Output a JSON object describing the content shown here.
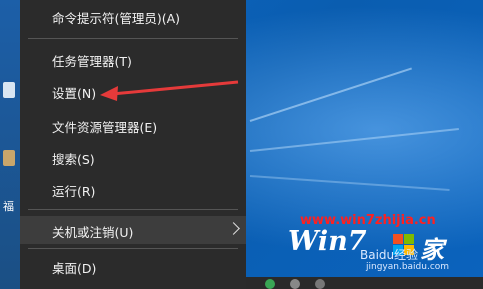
{
  "menu": {
    "items": [
      {
        "label": "命令提示符(管理员)(A)"
      },
      {
        "label": "任务管理器(T)"
      },
      {
        "label": "设置(N)"
      },
      {
        "label": "文件资源管理器(E)"
      },
      {
        "label": "搜索(S)"
      },
      {
        "label": "运行(R)"
      },
      {
        "label": "关机或注销(U)"
      },
      {
        "label": "桌面(D)"
      }
    ]
  },
  "desktop": {
    "icon_char_fu": "福"
  },
  "watermark": {
    "url": "www.win7zhijia.cn",
    "logo_text": "Win7",
    "logo_suffix": "家",
    "baidu_line1": "Baidu经验",
    "baidu_line2": "jingyan.baidu.com"
  },
  "colors": {
    "menu_bg": "#2b2b2b",
    "menu_text": "#f2f2f2",
    "arrow": "#e53a3a",
    "desktop_bg": "#0a5fb4",
    "watermark_red": "#ff2020"
  }
}
